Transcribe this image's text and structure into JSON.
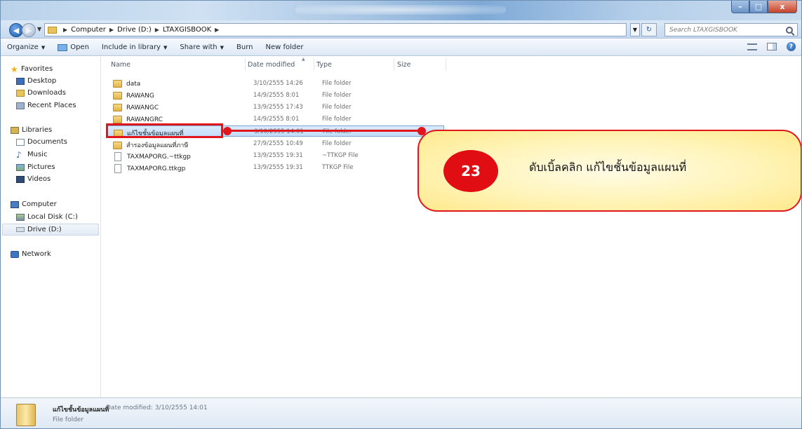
{
  "window": {
    "minimize": "–",
    "maximize": "□",
    "close": "x"
  },
  "address": {
    "crumbs": [
      "Computer",
      "Drive (D:)",
      "LTAXGISBOOK"
    ],
    "search_placeholder": "Search LTAXGISBOOK"
  },
  "toolbar": {
    "organize": "Organize",
    "open": "Open",
    "include_in_library": "Include in library",
    "share_with": "Share with",
    "burn": "Burn",
    "new_folder": "New folder"
  },
  "navpane": {
    "favorites": "Favorites",
    "desktop": "Desktop",
    "downloads": "Downloads",
    "recent_places": "Recent Places",
    "libraries": "Libraries",
    "documents": "Documents",
    "music": "Music",
    "pictures": "Pictures",
    "videos": "Videos",
    "computer": "Computer",
    "local_disk": "Local Disk (C:)",
    "drive_d": "Drive (D:)",
    "network": "Network"
  },
  "columns": {
    "name": "Name",
    "date_modified": "Date modified",
    "type": "Type",
    "size": "Size"
  },
  "files": [
    {
      "name": "data",
      "date": "3/10/2555 14:26",
      "type": "File folder",
      "kind": "folder"
    },
    {
      "name": "RAWANG",
      "date": "14/9/2555 8:01",
      "type": "File folder",
      "kind": "folder"
    },
    {
      "name": "RAWANGC",
      "date": "13/9/2555 17:43",
      "type": "File folder",
      "kind": "folder"
    },
    {
      "name": "RAWANGRC",
      "date": "14/9/2555 8:01",
      "type": "File folder",
      "kind": "folder"
    },
    {
      "name": "แก้ไขชั้นข้อมูลแผนที่",
      "date": "3/10/2555 14:01",
      "type": "File folder",
      "kind": "folder",
      "selected": true
    },
    {
      "name": "สำรองข้อมูลแผนที่ภาษี",
      "date": "27/9/2555 10:49",
      "type": "File folder",
      "kind": "folder"
    },
    {
      "name": "TAXMAPORG.~ttkgp",
      "date": "13/9/2555 19:31",
      "type": "~TTKGP File",
      "kind": "file"
    },
    {
      "name": "TAXMAPORG.ttkgp",
      "date": "13/9/2555 19:31",
      "type": "TTKGP File",
      "kind": "file"
    }
  ],
  "callout": {
    "step": "23",
    "text": "ดับเบิ้ลคลิก  แก้ไขชั้นข้อมูลแผนที่"
  },
  "details": {
    "name": "แก้ไขชั้นข้อมูลแผนที่",
    "date_label": "Date modified:",
    "date_value": "3/10/2555 14:01",
    "type": "File folder"
  },
  "colors": {
    "highlight_red": "#e0161c",
    "callout_fill": "#fff3b3",
    "badge_red": "#e00d13",
    "selection_blue": "#c1dcfa"
  }
}
